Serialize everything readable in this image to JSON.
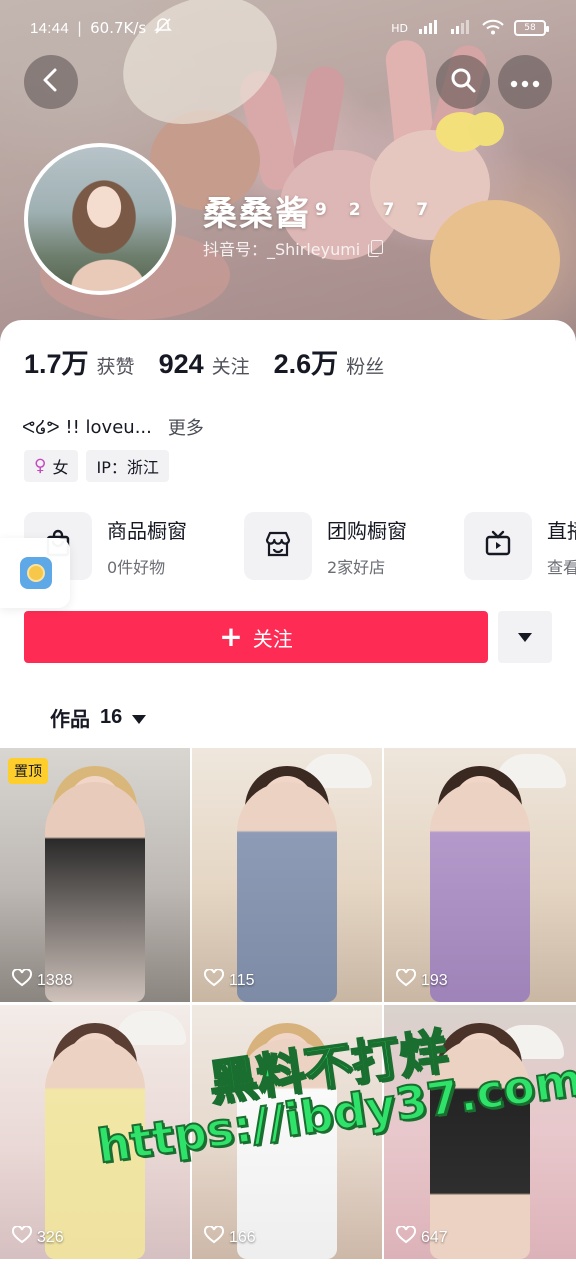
{
  "status_bar": {
    "time": "14:44",
    "network_speed": "60.7K/s",
    "signal_label": "HD",
    "battery": "58"
  },
  "profile": {
    "nickname": "桑桑酱",
    "nickname_suffix": "9 2 7 7",
    "douyin_id": "抖音号：_Shirleyumi",
    "bio": "ᕙ໒ᕗ !! loveu...",
    "bio_more": "更多",
    "gender_tag": "女",
    "ip_tag": "IP：浙江"
  },
  "stats": [
    {
      "value": "1.7万",
      "label": "获赞"
    },
    {
      "value": "924",
      "label": "关注"
    },
    {
      "value": "2.6万",
      "label": "粉丝"
    }
  ],
  "shops": [
    {
      "title": "商品橱窗",
      "subtitle": "0件好物",
      "icon": "shopping-bag-icon"
    },
    {
      "title": "团购橱窗",
      "subtitle": "2家好店",
      "icon": "storefront-icon"
    },
    {
      "title": "直播",
      "subtitle": "查看",
      "icon": "tv-icon"
    }
  ],
  "actions": {
    "follow_label": "关注"
  },
  "works_tab": {
    "label": "作品",
    "count": "16"
  },
  "videos": [
    {
      "likes": "1388",
      "pinned_label": "置顶"
    },
    {
      "likes": "115"
    },
    {
      "likes": "193"
    },
    {
      "likes": "326"
    },
    {
      "likes": "166"
    },
    {
      "likes": "647"
    }
  ],
  "watermark": {
    "line1": "黑料不打烊",
    "line2": "https://ibdy37.com"
  },
  "colors": {
    "accent": "#fe2c55",
    "pin_badge": "#fece2c",
    "watermark": "#2fe26a"
  }
}
